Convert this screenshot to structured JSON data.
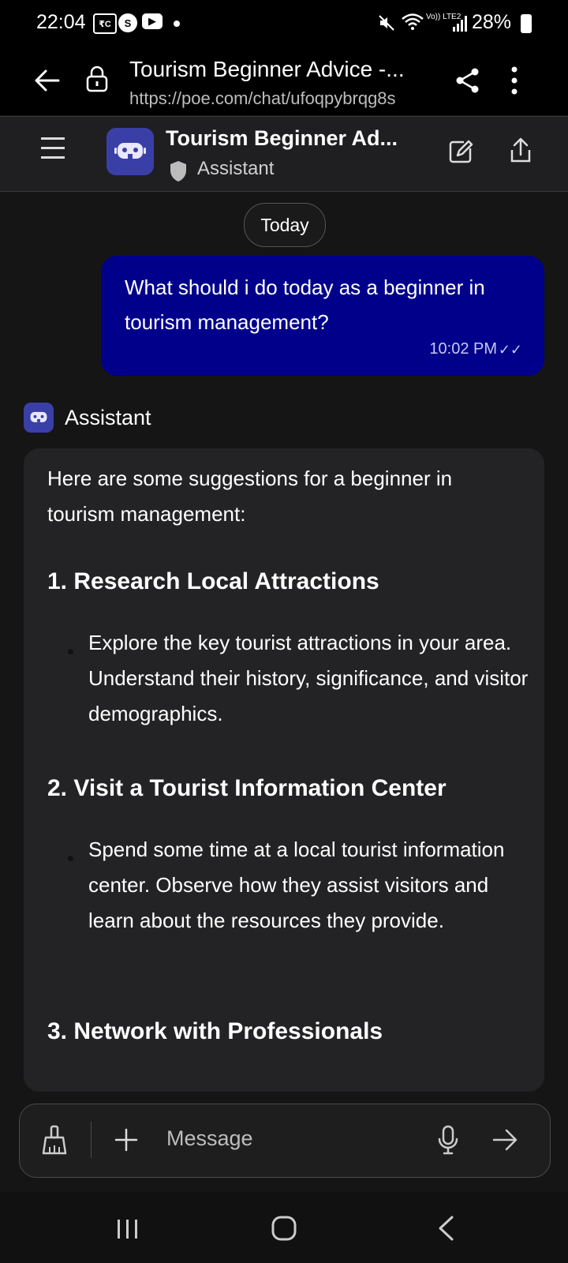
{
  "status_bar": {
    "time": "22:04",
    "battery": "28%",
    "network": "Vo)) LTE2"
  },
  "browser": {
    "title": "Tourism Beginner Advice -...",
    "url": "https://poe.com/chat/ufoqpybrqg8s"
  },
  "header": {
    "title": "Tourism Beginner Ad...",
    "subtitle": "Assistant"
  },
  "chat": {
    "date_chip": "Today",
    "user_message": {
      "text": "What should i do today as a beginner in tourism management?",
      "time": "10:02 PM"
    },
    "bot_name": "Assistant",
    "bot_message": {
      "intro": "Here are some suggestions for a beginner in tourism management:",
      "sections": [
        {
          "heading": "1. Research Local Attractions",
          "bullet": "Explore the key tourist attractions in your area. Understand their history, significance, and visitor demographics."
        },
        {
          "heading": "2. Visit a Tourist Information Center",
          "bullet": "Spend some time at a local tourist information center. Observe how they assist visitors and learn about the resources they provide."
        },
        {
          "heading": "3. Network with Professionals",
          "bullet": ""
        }
      ]
    }
  },
  "composer": {
    "placeholder": "Message"
  },
  "colors": {
    "user_bubble": "#00008b",
    "bot_avatar": "#3a3fa8",
    "background": "#151515",
    "card": "#232325"
  },
  "icons": [
    "back-arrow-icon",
    "lock-icon",
    "share-icon",
    "more-vert-icon",
    "menu-icon",
    "bot-icon",
    "shield-icon",
    "edit-icon",
    "export-icon",
    "broom-icon",
    "plus-icon",
    "mic-icon",
    "send-arrow-icon",
    "nav-recents-icon",
    "nav-home-icon",
    "nav-back-icon"
  ]
}
